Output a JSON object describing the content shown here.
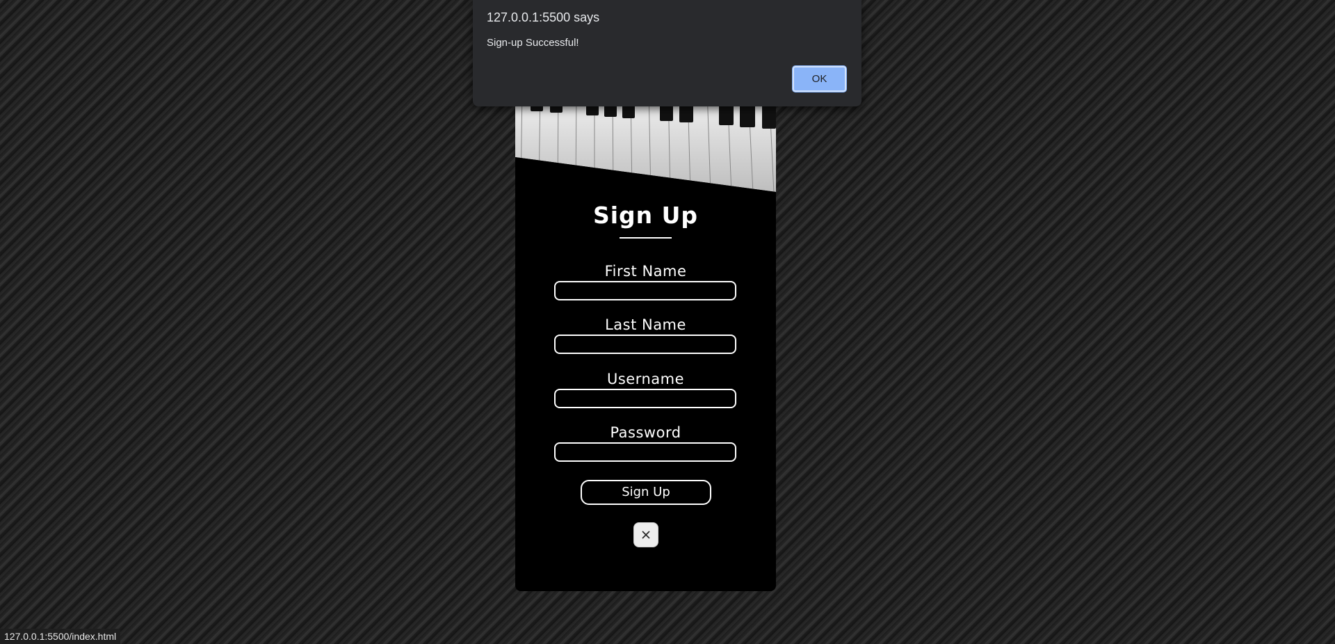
{
  "dialog": {
    "title": "127.0.0.1:5500 says",
    "message": "Sign-up Successful!",
    "ok_label": "OK"
  },
  "form": {
    "title": "Sign Up",
    "fields": [
      {
        "label": "First Name",
        "value": ""
      },
      {
        "label": "Last Name",
        "value": ""
      },
      {
        "label": "Username",
        "value": ""
      },
      {
        "label": "Password",
        "value": ""
      }
    ],
    "submit_label": "Sign Up",
    "close_icon": "close-icon"
  },
  "statusbar": {
    "url": "127.0.0.1:5500/index.html"
  },
  "colors": {
    "accent": "#8ab4f8",
    "card_background": "#000000",
    "text": "#ffffff"
  }
}
